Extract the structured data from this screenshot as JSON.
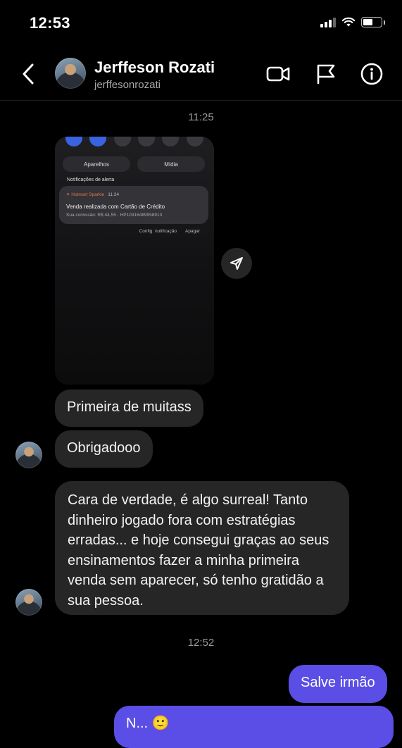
{
  "status_bar": {
    "time": "12:53",
    "battery_level": 0.55
  },
  "header": {
    "name": "Jerffeson Rozati",
    "username": "jerffesonrozati",
    "icons": [
      "chevron-left-icon",
      "video-camera-icon",
      "flag-icon",
      "info-icon"
    ]
  },
  "thread": {
    "timestamp_1": "11:25",
    "shared_screenshot": {
      "tab_devices": "Aparelhos",
      "tab_media": "Mídia",
      "alerts_heading": "Notificações de alerta",
      "app_name": "Hotmart Sparkle",
      "notif_time": "11:24",
      "notif_title": "Venda realizada com Cartão de Crédito",
      "notif_body": "Sua comissão: R$ 44,55 · HP10316489958913",
      "action_settings": "Config. notificação",
      "action_clear": "Apagar"
    },
    "messages": [
      {
        "from": "them",
        "text": "Primeira de muitass"
      },
      {
        "from": "them",
        "text": "Obrigadooo"
      },
      {
        "from": "them",
        "text": "Cara de verdade, é algo surreal! Tanto dinheiro jogado fora com estratégias erradas... e hoje consegui graças ao seus ensinamentos fazer a minha primeira venda sem aparecer, só tenho gratidão a sua pessoa."
      }
    ],
    "timestamp_2": "12:52",
    "sent_messages": [
      {
        "from": "me",
        "text": "Salve irmão"
      },
      {
        "from": "me",
        "text": "N... 🙂"
      }
    ]
  },
  "colors": {
    "background": "#000000",
    "received_bubble": "#262626",
    "sent_bubble": "#5a4ee6"
  }
}
